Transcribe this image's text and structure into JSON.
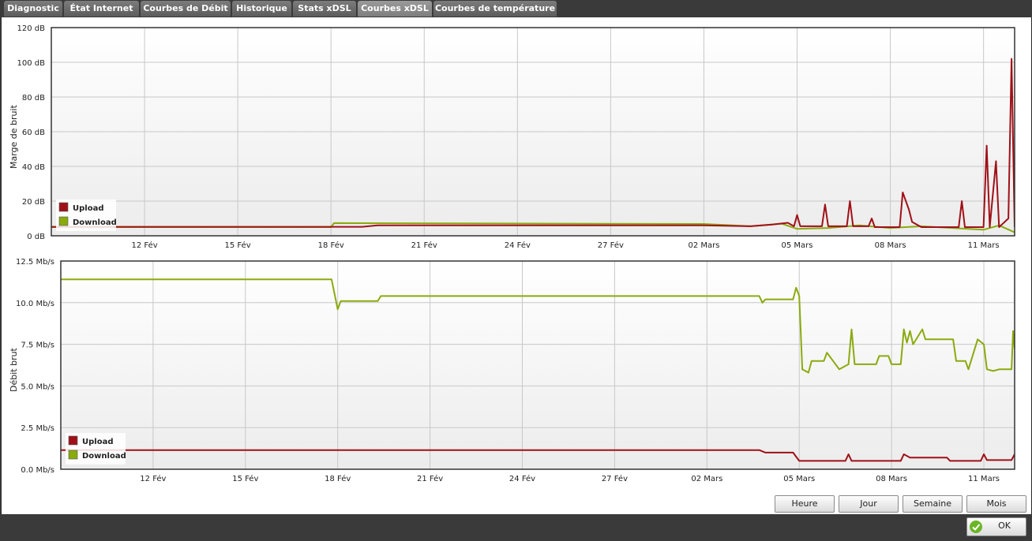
{
  "tabs": [
    {
      "label": "Diagnostic",
      "active": false
    },
    {
      "label": "État Internet",
      "active": false
    },
    {
      "label": "Courbes de Débit",
      "active": false
    },
    {
      "label": "Historique",
      "active": false
    },
    {
      "label": "Stats xDSL",
      "active": false
    },
    {
      "label": "Courbes xDSL",
      "active": true
    },
    {
      "label": "Courbes de température",
      "active": false
    }
  ],
  "range_buttons": {
    "hour": "Heure",
    "day": "Jour",
    "week": "Semaine",
    "month": "Mois"
  },
  "ok_button": {
    "label": "OK",
    "icon": "check-icon"
  },
  "colors": {
    "upload": "#a01018",
    "download": "#8aaa0e",
    "grid": "#c8c8c8"
  },
  "chart_data": [
    {
      "type": "line",
      "title": "",
      "ylabel": "Marge de bruit",
      "unit": "dB",
      "ylim": [
        0,
        120
      ],
      "yticks": [
        "0 dB",
        "20 dB",
        "40 dB",
        "60 dB",
        "80 dB",
        "100 dB",
        "120 dB"
      ],
      "xlim": [
        "Feb 9",
        "Mar 12"
      ],
      "xticks": [
        "12 Fév",
        "15 Fév",
        "18 Fév",
        "21 Fév",
        "24 Fév",
        "27 Fév",
        "02 Mars",
        "05 Mars",
        "08 Mars",
        "11 Mars"
      ],
      "legend": {
        "position": "bottom-left",
        "entries": [
          "Upload",
          "Download"
        ]
      },
      "grid": true,
      "series": [
        {
          "name": "Upload",
          "color": "#a01018",
          "points": [
            [
              "Feb 9",
              5.2
            ],
            [
              "Feb 19",
              5.2
            ],
            [
              "Feb 19.5",
              6.0
            ],
            [
              "Mar 2",
              6.0
            ],
            [
              "Mar 3.5",
              5.5
            ],
            [
              "Mar 4.2",
              6.5
            ],
            [
              "Mar 4.7",
              7.5
            ],
            [
              "Mar 4.9",
              5.5
            ],
            [
              "Mar 5",
              12
            ],
            [
              "Mar 5.1",
              5.5
            ],
            [
              "Mar 5.8",
              5.5
            ],
            [
              "Mar 5.9",
              18
            ],
            [
              "Mar 6",
              5.5
            ],
            [
              "Mar 6.6",
              5.5
            ],
            [
              "Mar 6.7",
              20
            ],
            [
              "Mar 6.8",
              5.5
            ],
            [
              "Mar 7.3",
              5.5
            ],
            [
              "Mar 7.4",
              10
            ],
            [
              "Mar 7.5",
              5
            ],
            [
              "Mar 8.3",
              5
            ],
            [
              "Mar 8.4",
              25
            ],
            [
              "Mar 8.6",
              15
            ],
            [
              "Mar 8.7",
              8
            ],
            [
              "Mar 9.0",
              5
            ],
            [
              "Mar 10.2",
              5
            ],
            [
              "Mar 10.3",
              20
            ],
            [
              "Mar 10.4",
              5
            ],
            [
              "Mar 11.0",
              5
            ],
            [
              "Mar 11.1",
              52
            ],
            [
              "Mar 11.2",
              5
            ],
            [
              "Mar 11.4",
              43
            ],
            [
              "Mar 11.5",
              5
            ],
            [
              "Mar 11.8",
              10
            ],
            [
              "Mar 11.9",
              102
            ],
            [
              "Mar 12",
              5
            ]
          ]
        },
        {
          "name": "Download",
          "color": "#8aaa0e",
          "points": [
            [
              "Feb 9",
              5.0
            ],
            [
              "Feb 18",
              5.0
            ],
            [
              "Feb 18.1",
              7.3
            ],
            [
              "Mar 2",
              6.8
            ],
            [
              "Mar 3.5",
              5.5
            ],
            [
              "Mar 4.5",
              7.0
            ],
            [
              "Mar 5",
              4.0
            ],
            [
              "Mar 6",
              4.5
            ],
            [
              "Mar 7",
              6.0
            ],
            [
              "Mar 8",
              4.5
            ],
            [
              "Mar 9",
              5.5
            ],
            [
              "Mar 10",
              4.5
            ],
            [
              "Mar 11",
              3.5
            ],
            [
              "Mar 11.5",
              6.0
            ],
            [
              "Mar 12",
              2.0
            ]
          ]
        }
      ]
    },
    {
      "type": "line",
      "title": "",
      "ylabel": "Débit brut",
      "unit": "Mb/s",
      "ylim": [
        0,
        12.5
      ],
      "yticks": [
        "0.0 Mb/s",
        "2.5 Mb/s",
        "5.0 Mb/s",
        "7.5 Mb/s",
        "10.0 Mb/s",
        "12.5 Mb/s"
      ],
      "xlim": [
        "Feb 9",
        "Mar 12"
      ],
      "xticks": [
        "12 Fév",
        "15 Fév",
        "18 Fév",
        "21 Fév",
        "24 Fév",
        "27 Fév",
        "02 Mars",
        "05 Mars",
        "08 Mars",
        "11 Mars"
      ],
      "legend": {
        "position": "bottom-left",
        "entries": [
          "Upload",
          "Download"
        ]
      },
      "grid": true,
      "series": [
        {
          "name": "Upload",
          "color": "#a01018",
          "points": [
            [
              "Feb 9",
              1.15
            ],
            [
              "Mar 3.7",
              1.15
            ],
            [
              "Mar 3.9",
              1.0
            ],
            [
              "Mar 4.8",
              1.0
            ],
            [
              "Mar 5.0",
              0.5
            ],
            [
              "Mar 6.5",
              0.5
            ],
            [
              "Mar 6.6",
              0.9
            ],
            [
              "Mar 6.7",
              0.5
            ],
            [
              "Mar 8.3",
              0.5
            ],
            [
              "Mar 8.4",
              0.9
            ],
            [
              "Mar 8.6",
              0.7
            ],
            [
              "Mar 9.8",
              0.7
            ],
            [
              "Mar 9.9",
              0.5
            ],
            [
              "Mar 10.9",
              0.5
            ],
            [
              "Mar 11.0",
              0.9
            ],
            [
              "Mar 11.1",
              0.55
            ],
            [
              "Mar 11.9",
              0.55
            ],
            [
              "Mar 12",
              0.9
            ]
          ]
        },
        {
          "name": "Download",
          "color": "#8aaa0e",
          "points": [
            [
              "Feb 9",
              11.4
            ],
            [
              "Feb 17.8",
              11.4
            ],
            [
              "Feb 18",
              9.6
            ],
            [
              "Feb 18.1",
              10.1
            ],
            [
              "Feb 19.3",
              10.1
            ],
            [
              "Feb 19.4",
              10.4
            ],
            [
              "Mar 3.7",
              10.4
            ],
            [
              "Mar 3.8",
              10.0
            ],
            [
              "Mar 3.9",
              10.2
            ],
            [
              "Mar 4.8",
              10.2
            ],
            [
              "Mar 4.9",
              10.9
            ],
            [
              "Mar 5.0",
              10.4
            ],
            [
              "Mar 5.1",
              6.0
            ],
            [
              "Mar 5.3",
              5.8
            ],
            [
              "Mar 5.4",
              6.5
            ],
            [
              "Mar 5.8",
              6.5
            ],
            [
              "Mar 5.9",
              7.0
            ],
            [
              "Mar 6.3",
              6.0
            ],
            [
              "Mar 6.6",
              6.3
            ],
            [
              "Mar 6.7",
              8.4
            ],
            [
              "Mar 6.8",
              6.3
            ],
            [
              "Mar 7.0",
              6.3
            ],
            [
              "Mar 7.5",
              6.3
            ],
            [
              "Mar 7.6",
              6.8
            ],
            [
              "Mar 7.9",
              6.8
            ],
            [
              "Mar 8.0",
              6.3
            ],
            [
              "Mar 8.3",
              6.3
            ],
            [
              "Mar 8.4",
              8.4
            ],
            [
              "Mar 8.5",
              7.6
            ],
            [
              "Mar 8.6",
              8.3
            ],
            [
              "Mar 8.7",
              7.5
            ],
            [
              "Mar 9.0",
              8.4
            ],
            [
              "Mar 9.1",
              7.8
            ],
            [
              "Mar 10.0",
              7.8
            ],
            [
              "Mar 10.1",
              6.5
            ],
            [
              "Mar 10.4",
              6.5
            ],
            [
              "Mar 10.5",
              6.0
            ],
            [
              "Mar 10.8",
              7.8
            ],
            [
              "Mar 11.0",
              7.5
            ],
            [
              "Mar 11.1",
              6.0
            ],
            [
              "Mar 11.3",
              5.9
            ],
            [
              "Mar 11.5",
              6.0
            ],
            [
              "Mar 11.9",
              6.0
            ],
            [
              "Mar 11.95",
              8.3
            ],
            [
              "Mar 12",
              7.2
            ]
          ]
        }
      ]
    }
  ]
}
